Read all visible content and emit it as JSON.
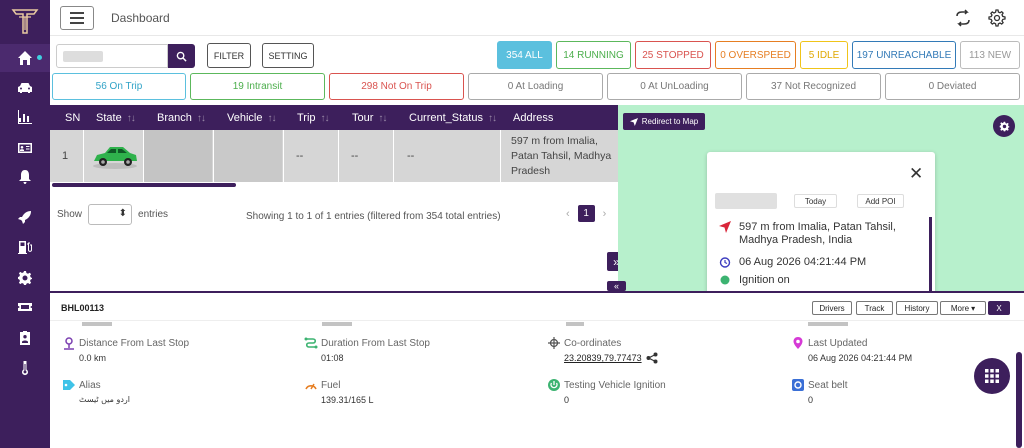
{
  "header": {
    "title": "Dashboard"
  },
  "filters": {
    "filter_label": "FILTER",
    "setting_label": "SETTING"
  },
  "status": {
    "all": "354 ALL",
    "running": "14 RUNNING",
    "stopped": "25 STOPPED",
    "overspeed": "0 OVERSPEED",
    "idle": "5 IDLE",
    "unreachable": "197 UNREACHABLE",
    "new": "113 NEW"
  },
  "trips": {
    "on_trip": "56  On Trip",
    "intransit": "19  Intransit",
    "not_on_trip": "298  Not On Trip",
    "at_loading": "0  At Loading",
    "at_unloading": "0  At UnLoading",
    "not_recognized": "37  Not Recognized",
    "deviated": "0  Deviated"
  },
  "table": {
    "columns": [
      "SN",
      "State",
      "Branch",
      "Vehicle",
      "Trip",
      "Tour",
      "Current_Status",
      "Address"
    ],
    "row": {
      "sn": "1",
      "trip": "--",
      "tour": "--",
      "current_status": "--",
      "address": "597 m from Imalia, Patan Tahsil, Madhya Pradesh"
    }
  },
  "pagination": {
    "show": "Show",
    "entries": "entries",
    "summary": "Showing 1 to 1 of 1 entries (filtered from 354 total entries)",
    "page": "1"
  },
  "map": {
    "redirect_label": "Redirect to Map",
    "popup": {
      "today": "Today",
      "add_poi": "Add POI",
      "address": "597 m from Imalia, Patan Tahsil,",
      "address2": "Madhya Pradesh, India",
      "datetime": "06 Aug 2026 04:21:44 PM",
      "ignition": "Ignition on"
    }
  },
  "detail": {
    "vehicle_id": "BHL00113",
    "buttons": {
      "drivers": "Drivers",
      "track": "Track",
      "history": "History",
      "more": "More",
      "close": "X"
    },
    "items": {
      "distance_label": "Distance From Last Stop",
      "distance_value": "0.0 km",
      "duration_label": "Duration From Last Stop",
      "duration_value": "01:08",
      "coords_label": "Co-ordinates",
      "coords_value": "23.20839,79.77473",
      "updated_label": "Last Updated",
      "updated_value": "06 Aug 2026 04:21:44 PM",
      "alias_label": "Alias",
      "alias_value": "اردو میں ٹیسٹ",
      "fuel_label": "Fuel",
      "fuel_value": "139.31/165 L",
      "ignition_label": "Testing Vehicle Ignition",
      "ignition_value": "0",
      "seatbelt_label": "Seat belt",
      "seatbelt_value": "0"
    }
  },
  "colors": {
    "brand": "#3d1f5c",
    "all": "#5bc0de",
    "running": "#5cb85c",
    "stopped": "#d9534f",
    "overspeed": "#e67e22",
    "idle": "#f0c419",
    "unreachable": "#337ab7",
    "new": "#aaaaaa"
  }
}
